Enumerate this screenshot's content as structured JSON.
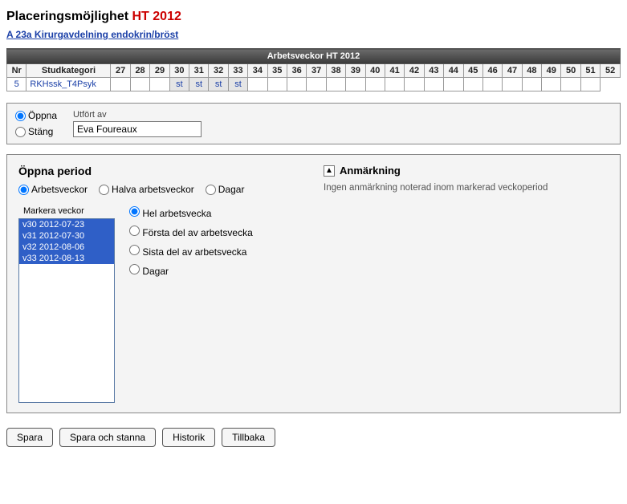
{
  "page": {
    "title_prefix": "Placeringsmöjlighet",
    "term": "HT 2012",
    "department": "A 23a Kirurgavdelning endokrin/bröst"
  },
  "weeks_table": {
    "header": "Arbetsveckor HT 2012",
    "cols": {
      "nr": "Nr",
      "studkat": "Studkategori"
    },
    "week_numbers": [
      "27",
      "28",
      "29",
      "30",
      "31",
      "32",
      "33",
      "34",
      "35",
      "36",
      "37",
      "38",
      "39",
      "40",
      "41",
      "42",
      "43",
      "44",
      "45",
      "46",
      "47",
      "48",
      "49",
      "50",
      "51",
      "52"
    ],
    "row": {
      "nr": "5",
      "studkat": "RKHssk_T4Psyk",
      "cells": {
        "30": "st",
        "31": "st",
        "32": "st",
        "33": "st"
      }
    }
  },
  "top_panel": {
    "open_label": "Öppna",
    "close_label": "Stäng",
    "performed_by_label": "Utfört av",
    "performed_by_value": "Eva Foureaux"
  },
  "open_period": {
    "title": "Öppna period",
    "mode": {
      "arbetsveckor": "Arbetsveckor",
      "halva": "Halva arbetsveckor",
      "dagar": "Dagar"
    },
    "mark_weeks_label": "Markera veckor",
    "weeks": [
      "v30 2012-07-23",
      "v31 2012-07-30",
      "v32 2012-08-06",
      "v33 2012-08-13"
    ],
    "sub": {
      "hel": "Hel arbetsvecka",
      "forsta": "Första del av arbetsvecka",
      "sista": "Sista del av arbetsvecka",
      "dagar": "Dagar"
    }
  },
  "annotation": {
    "title": "Anmärkning",
    "text": "Ingen anmärkning noterad inom markerad veckoperiod"
  },
  "buttons": {
    "save": "Spara",
    "save_stay": "Spara och stanna",
    "history": "Historik",
    "back": "Tillbaka"
  }
}
